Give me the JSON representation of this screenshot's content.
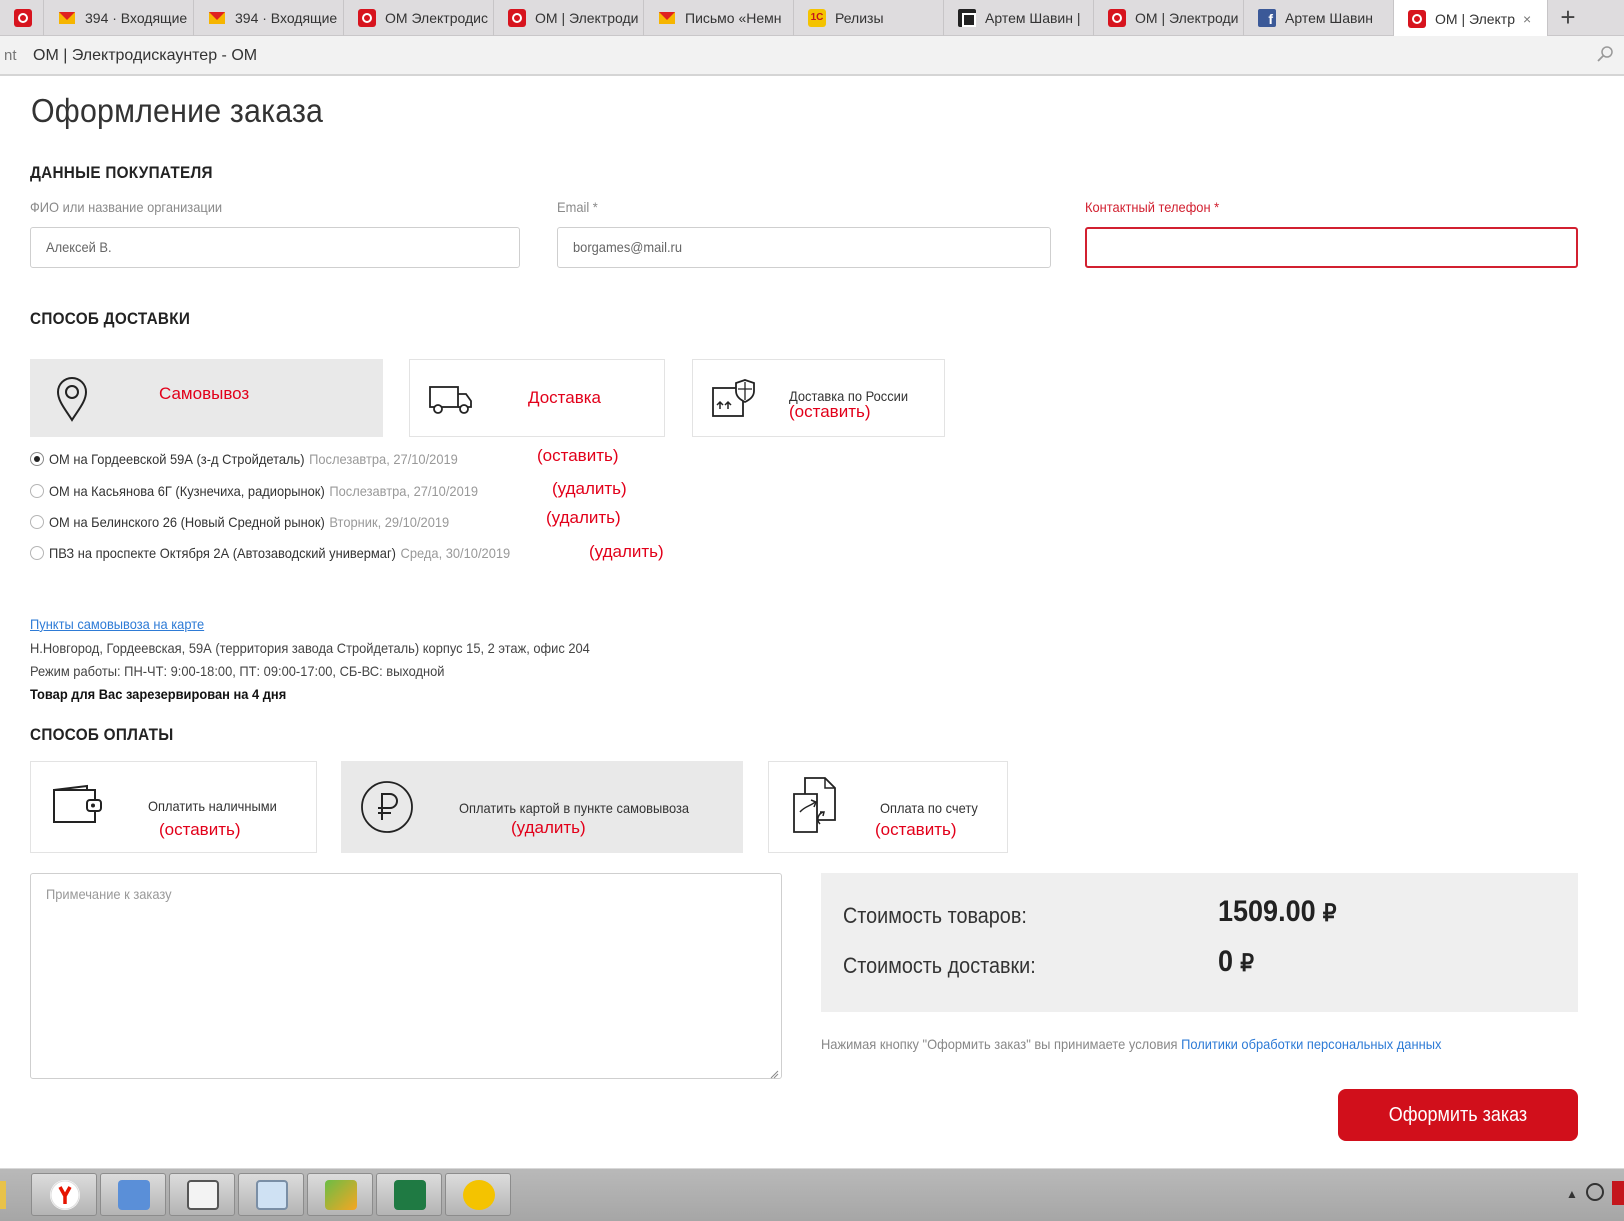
{
  "browser": {
    "tabs": [
      {
        "icon": "om-icon",
        "label": ""
      },
      {
        "icon": "mail-icon",
        "label": "394 · Входящие"
      },
      {
        "icon": "mail-icon",
        "label": "394 · Входящие"
      },
      {
        "icon": "om-icon",
        "label": "ОМ Электродис"
      },
      {
        "icon": "om-icon",
        "label": "ОМ | Электроди"
      },
      {
        "icon": "mail-icon",
        "label": "Письмо «Немн"
      },
      {
        "icon": "1c-icon",
        "label": "Релизы"
      },
      {
        "icon": "trello-icon",
        "label": "Артем Шавин |"
      },
      {
        "icon": "om-icon",
        "label": "ОМ | Электроди"
      },
      {
        "icon": "facebook-icon",
        "label": "Артем Шавин"
      },
      {
        "icon": "om-icon",
        "label": "ОМ | Электр"
      }
    ],
    "new_tab": "+",
    "close_glyph": "×",
    "address_prefix": "nt",
    "page_title": "ОМ | Электродискаунтер - ОМ"
  },
  "page": {
    "title": "Оформление заказа",
    "buyer": {
      "section_title": "ДАННЫЕ ПОКУПАТЕЛЯ",
      "name_label": "ФИО или название организации",
      "name_value": "Алексей В.",
      "email_label": "Email *",
      "email_value": "borgames@mail.ru",
      "phone_label": "Контактный телефон *",
      "phone_value": ""
    },
    "delivery": {
      "section_title": "СПОСОБ ДОСТАВКИ",
      "options": [
        {
          "label": "Самовывоз",
          "icon": "map-pin-icon",
          "selected": true
        },
        {
          "label": "Доставка",
          "icon": "truck-icon",
          "selected": false
        },
        {
          "label": "Доставка по России",
          "note": "(оставить)",
          "icon": "box-shield-icon",
          "selected": false
        }
      ],
      "pickup_points": [
        {
          "name": "ОМ на Гордеевской 59А (з-д Стройдеталь)",
          "date": "Послезавтра, 27/10/2019",
          "note": "(оставить)",
          "checked": true
        },
        {
          "name": "ОМ на Касьянова 6Г (Кузнечиха, радиорынок)",
          "date": "Послезавтра, 27/10/2019",
          "note": "(удалить)",
          "checked": false
        },
        {
          "name": "ОМ на Белинского 26 (Новый Средной рынок)",
          "date": "Вторник, 29/10/2019",
          "note": "(удалить)",
          "checked": false
        },
        {
          "name": "ПВЗ на проспекте Октября 2А (Автозаводский универмаг)",
          "date": "Среда, 30/10/2019",
          "note": "(удалить)",
          "checked": false
        }
      ],
      "map_link": "Пункты самовывоза на карте",
      "address": "Н.Новгород, Гордеевская, 59А (территория завода Стройдеталь) корпус 15, 2 этаж, офис 204",
      "hours": "Режим работы: ПН-ЧТ: 9:00-18:00, ПТ: 09:00-17:00, СБ-ВС: выходной",
      "reserve": "Товар для Вас зарезервирован на 4 дня"
    },
    "payment": {
      "section_title": "СПОСОБ ОПЛАТЫ",
      "options": [
        {
          "label": "Оплатить наличными",
          "note": "(оставить)",
          "icon": "wallet-icon",
          "selected": false
        },
        {
          "label": "Оплатить картой в пункте самовывоза",
          "note": "(удалить)",
          "icon": "ruble-icon",
          "selected": true
        },
        {
          "label": "Оплата по счету",
          "note": "(оставить)",
          "icon": "documents-icon",
          "selected": false
        }
      ]
    },
    "comment_placeholder": "Примечание к заказу",
    "totals": {
      "goods_label": "Стоимость товаров:",
      "goods_value": "1509.00",
      "delivery_label": "Стоимость доставки:",
      "delivery_value": "0",
      "currency": "₽"
    },
    "terms_text": "Нажимая кнопку \"Оформить заказ\" вы принимаете условия ",
    "terms_link": "Политики обработки персональных данных",
    "submit_label": "Оформить заказ"
  },
  "colors": {
    "accent": "#d10f1b",
    "error": "#d22030",
    "note_red": "#e2001a",
    "link": "#2e7bd6"
  },
  "taskbar": {
    "apps": [
      "yandex-browser-icon",
      "control-panel-icon",
      "clipboard-icon",
      "monitor-icon",
      "maps-icon",
      "excel-icon",
      "1c-icon"
    ]
  }
}
